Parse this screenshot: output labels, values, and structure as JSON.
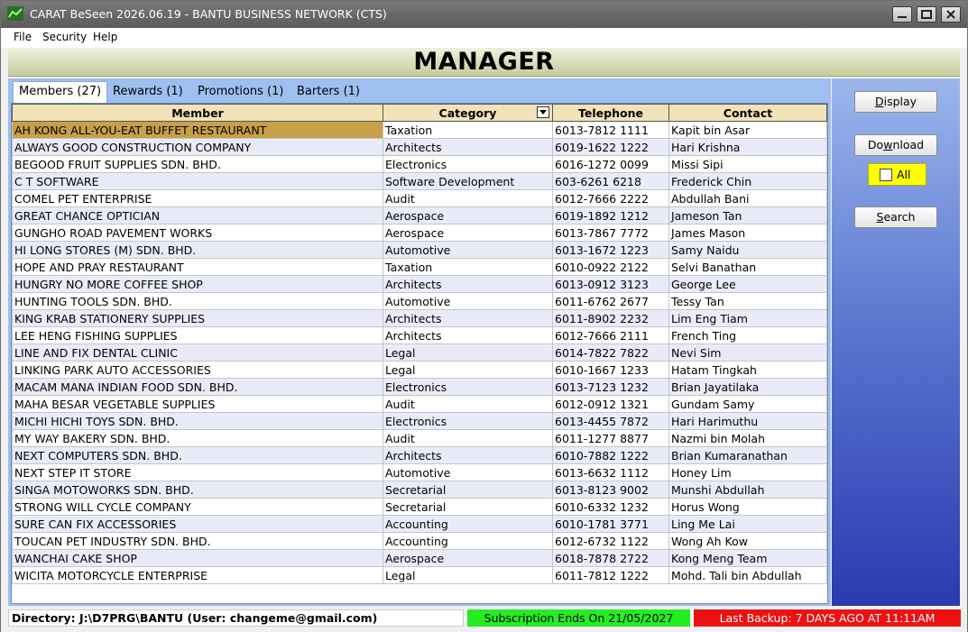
{
  "window": {
    "title": "CARAT BeSeen 2026.06.19 - BANTU BUSINESS NETWORK (CTS)",
    "icon": "chart-app-icon"
  },
  "menu": [
    {
      "label": "File"
    },
    {
      "label": "Security"
    },
    {
      "label": "Help"
    }
  ],
  "header": {
    "title": "MANAGER"
  },
  "tabs": [
    {
      "label": "Members (27)",
      "active": true
    },
    {
      "label": "Rewards (1)",
      "active": false
    },
    {
      "label": "Promotions (1)",
      "active": false
    },
    {
      "label": "Barters (1)",
      "active": false
    }
  ],
  "grid": {
    "columns": [
      "Member",
      "Category",
      "Telephone",
      "Contact"
    ],
    "selected_row": 0,
    "rows": [
      [
        "AH KONG ALL-YOU-EAT BUFFET RESTAURANT",
        "Taxation",
        "6013-7812 1111",
        "Kapit bin Asar"
      ],
      [
        "ALWAYS GOOD CONSTRUCTION COMPANY",
        "Architects",
        "6019-1622 1222",
        "Hari Krishna"
      ],
      [
        "BEGOOD FRUIT SUPPLIES SDN. BHD.",
        "Electronics",
        "6016-1272 0099",
        "Missi Sipi"
      ],
      [
        "C T SOFTWARE",
        "Software Development",
        "603-6261 6218",
        "Frederick Chin"
      ],
      [
        "COMEL PET ENTERPRISE",
        "Audit",
        "6012-7666 2222",
        "Abdullah Bani"
      ],
      [
        "GREAT CHANCE OPTICIAN",
        "Aerospace",
        "6019-1892 1212",
        "Jameson Tan"
      ],
      [
        "GUNGHO ROAD PAVEMENT WORKS",
        "Aerospace",
        "6013-7867 7772",
        "James Mason"
      ],
      [
        "HI LONG STORES (M) SDN. BHD.",
        "Automotive",
        "6013-1672 1223",
        "Samy Naidu"
      ],
      [
        "HOPE AND PRAY RESTAURANT",
        "Taxation",
        "6010-0922 2122",
        "Selvi Banathan"
      ],
      [
        "HUNGRY NO MORE COFFEE SHOP",
        "Architects",
        "6013-0912 3123",
        "George Lee"
      ],
      [
        "HUNTING TOOLS SDN. BHD.",
        "Automotive",
        "6011-6762 2677",
        "Tessy Tan"
      ],
      [
        "KING KRAB STATIONERY SUPPLIES",
        "Architects",
        "6011-8902 2232",
        "Lim Eng Tiam"
      ],
      [
        "LEE HENG FISHING SUPPLIES",
        "Architects",
        "6012-7666 2111",
        "French Ting"
      ],
      [
        "LINE AND FIX DENTAL CLINIC",
        "Legal",
        "6014-7822 7822",
        "Nevi Sim"
      ],
      [
        "LINKING PARK AUTO ACCESSORIES",
        "Legal",
        "6010-1667 1233",
        "Hatam Tingkah"
      ],
      [
        "MACAM MANA INDIAN FOOD SDN. BHD.",
        "Electronics",
        "6013-7123 1232",
        "Brian Jayatilaka"
      ],
      [
        "MAHA BESAR VEGETABLE SUPPLIES",
        "Audit",
        "6012-0912 1321",
        "Gundam Samy"
      ],
      [
        "MICHI HICHI TOYS SDN. BHD.",
        "Electronics",
        "6013-4455 7872",
        "Hari Harimuthu"
      ],
      [
        "MY WAY BAKERY SDN. BHD.",
        "Audit",
        "6011-1277 8877",
        "Nazmi bin Molah"
      ],
      [
        "NEXT COMPUTERS SDN. BHD.",
        "Architects",
        "6010-7882 1222",
        "Brian Kumaranathan"
      ],
      [
        "NEXT STEP IT STORE",
        "Automotive",
        "6013-6632 1112",
        "Honey Lim"
      ],
      [
        "SINGA MOTOWORKS SDN. BHD.",
        "Secretarial",
        "6013-8123 9002",
        "Munshi Abdullah"
      ],
      [
        "STRONG WILL CYCLE COMPANY",
        "Secretarial",
        "6010-6332 1232",
        "Horus Wong"
      ],
      [
        "SURE CAN FIX ACCESSORIES",
        "Accounting",
        "6010-1781 3771",
        "Ling Me Lai"
      ],
      [
        "TOUCAN PET INDUSTRY SDN. BHD.",
        "Accounting",
        "6012-6732 1122",
        "Wong Ah Kow"
      ],
      [
        "WANCHAI CAKE SHOP",
        "Aerospace",
        "6018-7878 2722",
        "Kong Meng Team"
      ],
      [
        "WICITA MOTORCYCLE ENTERPRISE",
        "Legal",
        "6011-7812 1222",
        "Mohd. Tali bin Abdullah"
      ]
    ]
  },
  "sidebar": {
    "display_label": "Display",
    "download_label": "Download",
    "all_label": "All",
    "all_checked": false,
    "search_label": "Search"
  },
  "status": {
    "directory": "Directory: J:\\D7PRG\\BANTU (User: changeme@gmail.com)",
    "subscription": "Subscription Ends On 21/05/2027",
    "backup": "Last Backup: 7 DAYS AGO AT 11:11AM"
  },
  "colors": {
    "header_bg": "#c4cd9c",
    "grid_header_bg": "#f1e3b8",
    "selected_cell": "#c8a04a",
    "right_panel_bottom": "#2a3ab0",
    "subscription_bg": "#22ee22",
    "backup_bg": "#ee1111",
    "all_box_bg": "#ffff00"
  }
}
